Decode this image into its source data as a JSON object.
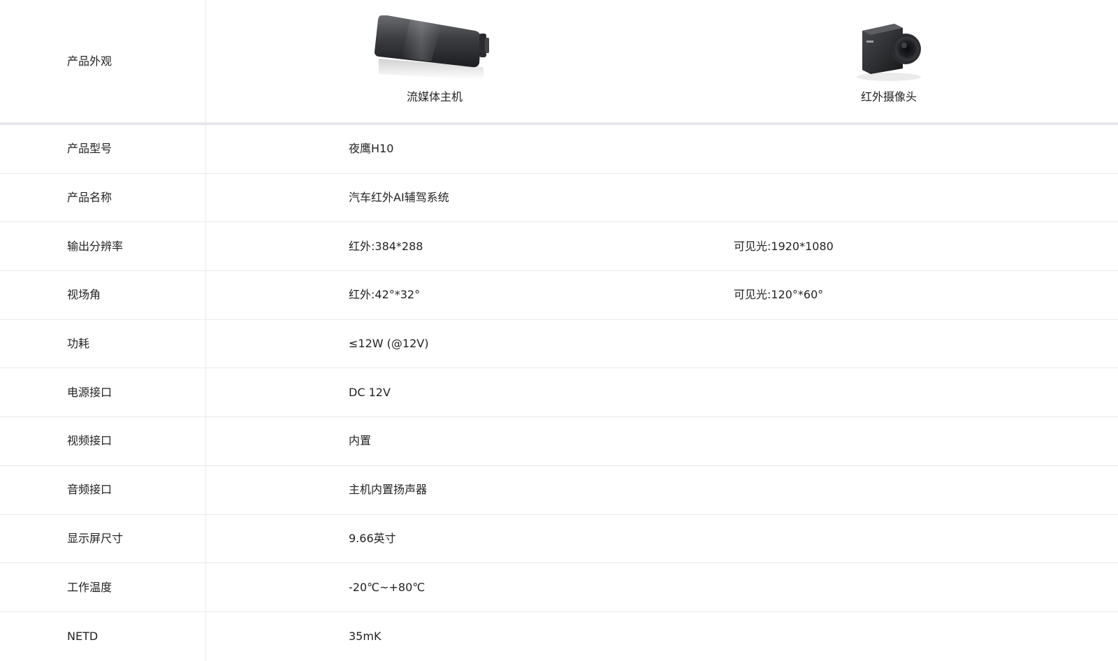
{
  "header": {
    "label": "产品外观",
    "products": [
      {
        "name": "流媒体主机",
        "icon": "rearview-mirror-host-image"
      },
      {
        "name": "红外摄像头",
        "icon": "infrared-camera-image"
      }
    ]
  },
  "rows": [
    {
      "label": "产品型号",
      "val1": "夜鹰H10",
      "val2": ""
    },
    {
      "label": "产品名称",
      "val1": "汽车红外AI辅驾系统",
      "val2": ""
    },
    {
      "label": "输出分辨率",
      "val1": "红外:384*288",
      "val2": "可见光:1920*1080"
    },
    {
      "label": "视场角",
      "val1": "红外:42°*32°",
      "val2": "可见光:120°*60°"
    },
    {
      "label": "功耗",
      "val1": "≤12W (@12V)",
      "val2": ""
    },
    {
      "label": "电源接口",
      "val1": "DC 12V",
      "val2": ""
    },
    {
      "label": "视频接口",
      "val1": "内置",
      "val2": ""
    },
    {
      "label": "音频接口",
      "val1": "主机内置扬声器",
      "val2": ""
    },
    {
      "label": "显示屏尺寸",
      "val1": "9.66英寸",
      "val2": ""
    },
    {
      "label": "工作温度",
      "val1": "-20℃~+80℃",
      "val2": ""
    },
    {
      "label": "NETD",
      "val1": "35mK",
      "val2": ""
    }
  ],
  "colors": {
    "divider": "#e9e9ee",
    "header_border": "#e6e6ef",
    "text": "#222222"
  }
}
